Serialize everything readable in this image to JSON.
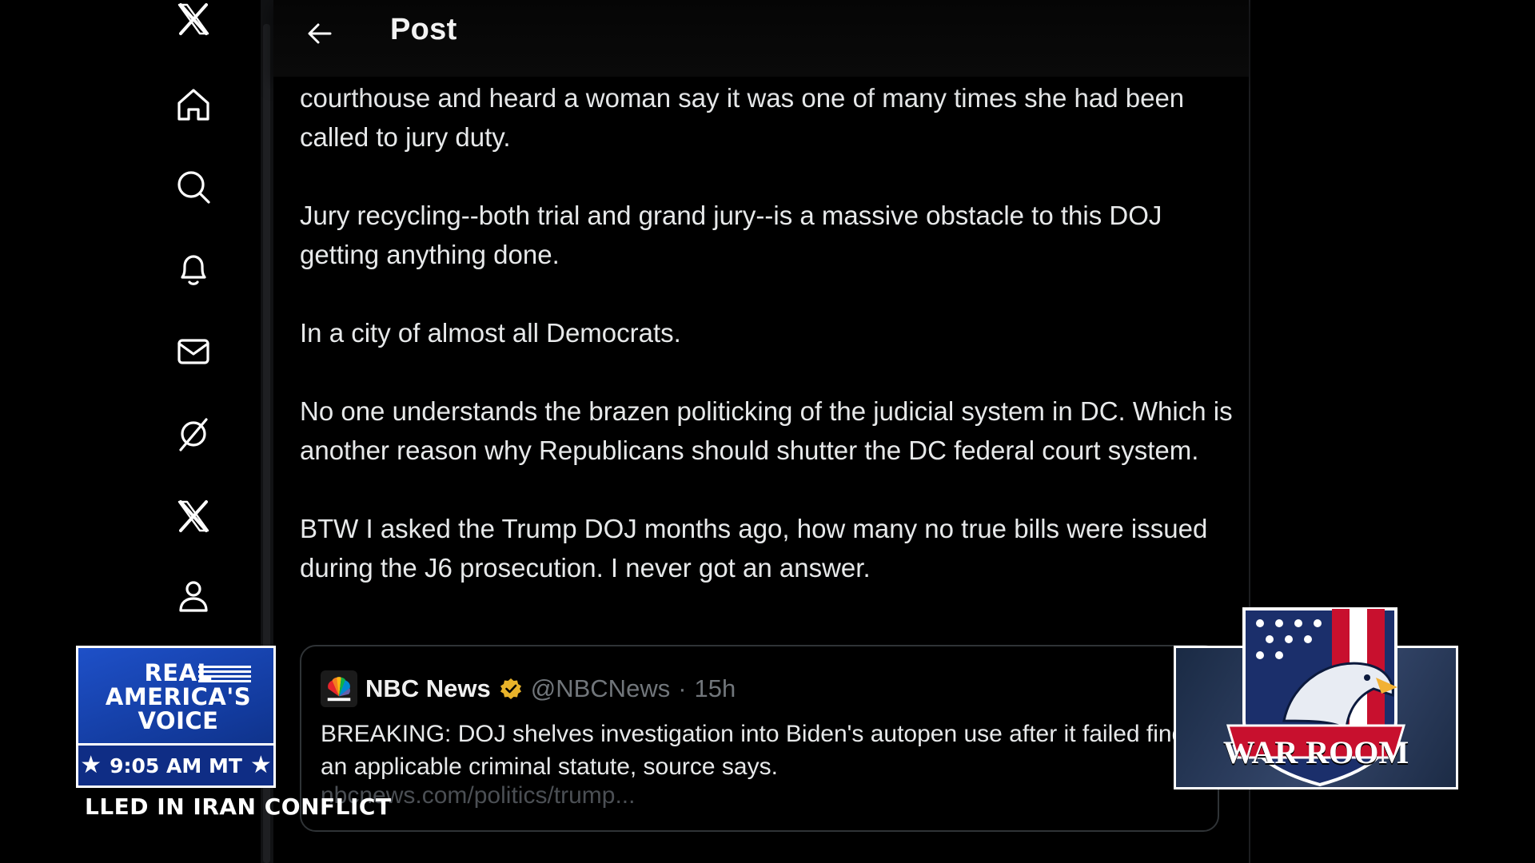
{
  "header": {
    "title": "Post"
  },
  "nav": {
    "items": [
      {
        "name": "x-logo-icon"
      },
      {
        "name": "home-icon"
      },
      {
        "name": "search-icon"
      },
      {
        "name": "notifications-bell-icon"
      },
      {
        "name": "messages-mail-icon"
      },
      {
        "name": "grok-icon"
      },
      {
        "name": "premium-x-icon"
      },
      {
        "name": "profile-icon"
      }
    ]
  },
  "post": {
    "paragraphs": [
      "courthouse and heard a woman say it was one of many times she had been called to jury duty.",
      "Jury recycling--both trial and grand jury--is a massive obstacle to this DOJ getting anything done.",
      "In a city of almost all Democrats.",
      "No one understands the brazen politicking of the judicial system in DC. Which is another reason why Republicans should shutter the DC federal court system.",
      "BTW I asked the Trump DOJ months ago, how many no true bills were issued during the J6 prosecution. I never got an answer."
    ]
  },
  "quote": {
    "name": "NBC News",
    "handle": "@NBCNews",
    "separator": "·",
    "time": "15h",
    "text": "BREAKING: DOJ shelves investigation into Biden's autopen use after it failed find an applicable criminal statute, source says.",
    "link": "nbcnews.com/politics/trump..."
  },
  "broadcast": {
    "rav_logo": "REAL AMERICA'S VOICE",
    "time": "9:05 AM MT",
    "ticker": "LLED IN IRAN CONFLICT",
    "war_room": "WAR ROOM"
  },
  "colors": {
    "background": "#000000",
    "text": "#e7e9ea",
    "muted": "#71767b",
    "verified": "#e8b32a",
    "rav_blue": "#1e50c8"
  }
}
